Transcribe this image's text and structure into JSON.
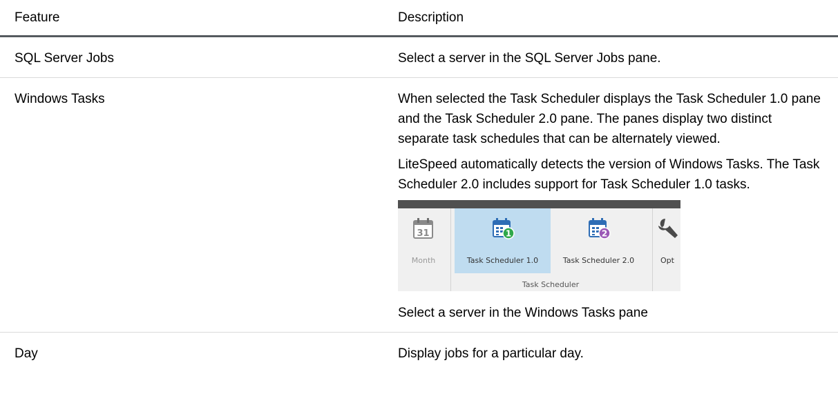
{
  "table": {
    "headers": {
      "feature": "Feature",
      "description": "Description"
    },
    "rows": [
      {
        "feature": "SQL Server Jobs",
        "description": [
          "Select a server in the SQL Server Jobs pane."
        ]
      },
      {
        "feature": "Windows Tasks",
        "description": [
          "When selected the Task Scheduler displays the Task Scheduler 1.0 pane and the Task Scheduler 2.0 pane. The panes display two distinct separate task schedules that can be alternately viewed.",
          "LiteSpeed automatically detects the version of Windows Tasks. The Task Scheduler 2.0 includes support for Task Scheduler 1.0 tasks.",
          "Select a server in the Windows Tasks pane"
        ]
      },
      {
        "feature": "Day",
        "description": [
          "Display jobs for a particular day."
        ]
      }
    ]
  },
  "ribbon": {
    "month": {
      "label": "Month",
      "icon": "calendar-31-icon",
      "day_number": "31"
    },
    "ts1": {
      "label": "Task Scheduler 1.0",
      "icon": "task-scheduler-1-icon",
      "badge": "1",
      "badge_color": "#2ea84a"
    },
    "ts2": {
      "label": "Task Scheduler 2.0",
      "icon": "task-scheduler-2-icon",
      "badge": "2",
      "badge_color": "#9b59b6"
    },
    "options": {
      "label": "Opt",
      "icon": "wrench-icon"
    },
    "group_label": "Task Scheduler",
    "selected_color": "#bfdcf0"
  },
  "colors": {
    "header_rule": "#555a5f",
    "row_rule": "#d9d9d9",
    "calendar_blue": "#2e6db5"
  }
}
